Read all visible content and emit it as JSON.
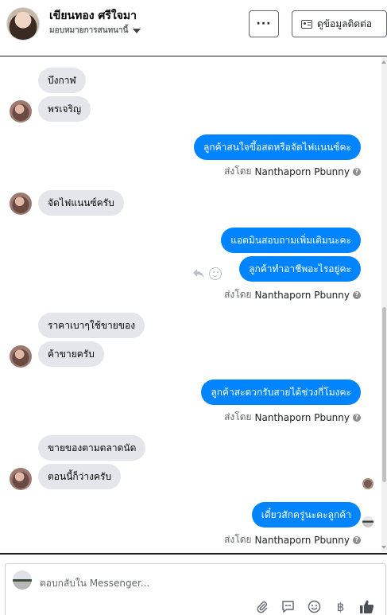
{
  "header": {
    "contact_name": "เขียนทอง ศรีใจมา",
    "assigned_label": "มอบหมายการสนทนานี้",
    "more_label": "···",
    "contact_info_label": "ดูข้อมูลติดต่อ"
  },
  "messages": {
    "m1": "บึงกาฬ",
    "m2": "พรเจริญ",
    "m3": "ลูกค้าสนใจขึ้อสดหรือจัดไฟแนนซ์คะ",
    "m4": "จัดไฟแนนซ์ครับ",
    "m5": "แอดมินสอบถามเพิ่มเติมนะคะ",
    "m6": "ลูกค้าทำอาชีพอะไรอยู่คะ",
    "m7": "ราคาเบาๆใช้ขายของ",
    "m8": "ค้าขายครับ",
    "m9": "ลูกค้าสะดวกรับสายได้ช่วงกี่โมงคะ",
    "m10": "ขายของตามตลาดนัด",
    "m11": "ตอนนี้ก็ว่างครับ",
    "m12": "เดี๋ยวสักครู่นะคะลูกค้า"
  },
  "sent_by": {
    "prefix": "ส่งโดย",
    "name": "Nanthaporn Pbunny",
    "info": "?"
  },
  "composer": {
    "placeholder": "ตอบกลับใน Messenger...",
    "tools": [
      "paperclip-icon",
      "chat-bubble-icon",
      "emoji-icon",
      "baht-icon",
      "thumbs-up-icon"
    ],
    "baht_symbol": "฿"
  },
  "colors": {
    "outgoing": "#0084ff",
    "incoming": "#e4e6eb"
  }
}
